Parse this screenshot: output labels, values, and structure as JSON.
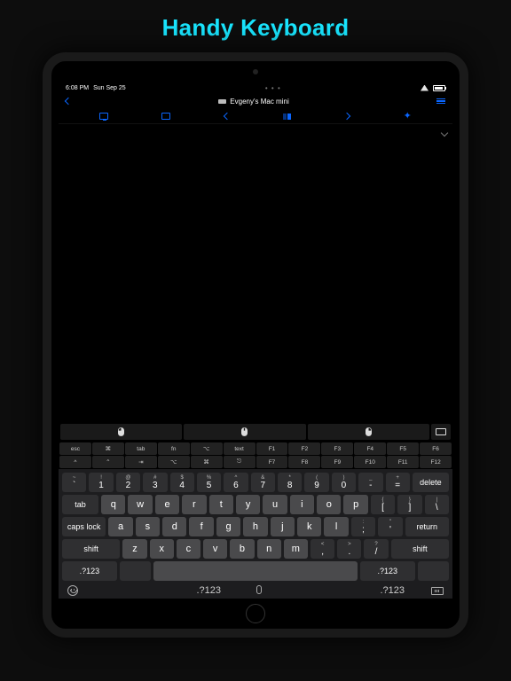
{
  "page": {
    "title": "Handy Keyboard"
  },
  "status": {
    "time": "6:08 PM",
    "date": "Sun Sep 25"
  },
  "nav": {
    "device_name": "Evgeny's Mac mini"
  },
  "mouse_row": {
    "left": "left",
    "middle": "middle",
    "right": "right"
  },
  "special_rows": [
    [
      "esc",
      "⌘",
      "tab",
      "fn",
      "⌥",
      "text",
      "F1",
      "F2",
      "F3",
      "F4",
      "F5",
      "F6"
    ],
    [
      "^",
      "⌃",
      "⇥",
      "⌥",
      "⌘",
      "⎋",
      "F7",
      "F8",
      "F9",
      "F10",
      "F11",
      "F12"
    ]
  ],
  "num_row": [
    {
      "sup": "~",
      "main": "`"
    },
    {
      "sup": "!",
      "main": "1"
    },
    {
      "sup": "@",
      "main": "2"
    },
    {
      "sup": "#",
      "main": "3"
    },
    {
      "sup": "$",
      "main": "4"
    },
    {
      "sup": "%",
      "main": "5"
    },
    {
      "sup": "^",
      "main": "6"
    },
    {
      "sup": "&",
      "main": "7"
    },
    {
      "sup": "*",
      "main": "8"
    },
    {
      "sup": "(",
      "main": "9"
    },
    {
      "sup": ")",
      "main": "0"
    },
    {
      "sup": "_",
      "main": "-"
    },
    {
      "sup": "+",
      "main": "="
    }
  ],
  "delete_label": "delete",
  "row_q": [
    "q",
    "w",
    "e",
    "r",
    "t",
    "y",
    "u",
    "i",
    "o",
    "p"
  ],
  "row_q_tail": [
    {
      "sup": "{",
      "main": "["
    },
    {
      "sup": "}",
      "main": "]"
    },
    {
      "sup": "|",
      "main": "\\"
    }
  ],
  "tab_label": "tab",
  "row_a": [
    "a",
    "s",
    "d",
    "f",
    "g",
    "h",
    "j",
    "k",
    "l"
  ],
  "row_a_tail": [
    {
      "sup": ":",
      "main": ";"
    },
    {
      "sup": "\"",
      "main": "'"
    }
  ],
  "caps_label": "caps lock",
  "return_label": "return",
  "row_z": [
    "z",
    "x",
    "c",
    "v",
    "b",
    "n",
    "m"
  ],
  "row_z_tail": [
    {
      "sup": "<",
      "main": ","
    },
    {
      "sup": ">",
      "main": "."
    },
    {
      "sup": "?",
      "main": "/"
    }
  ],
  "shift_label": "shift",
  "sym_label": ".?123"
}
